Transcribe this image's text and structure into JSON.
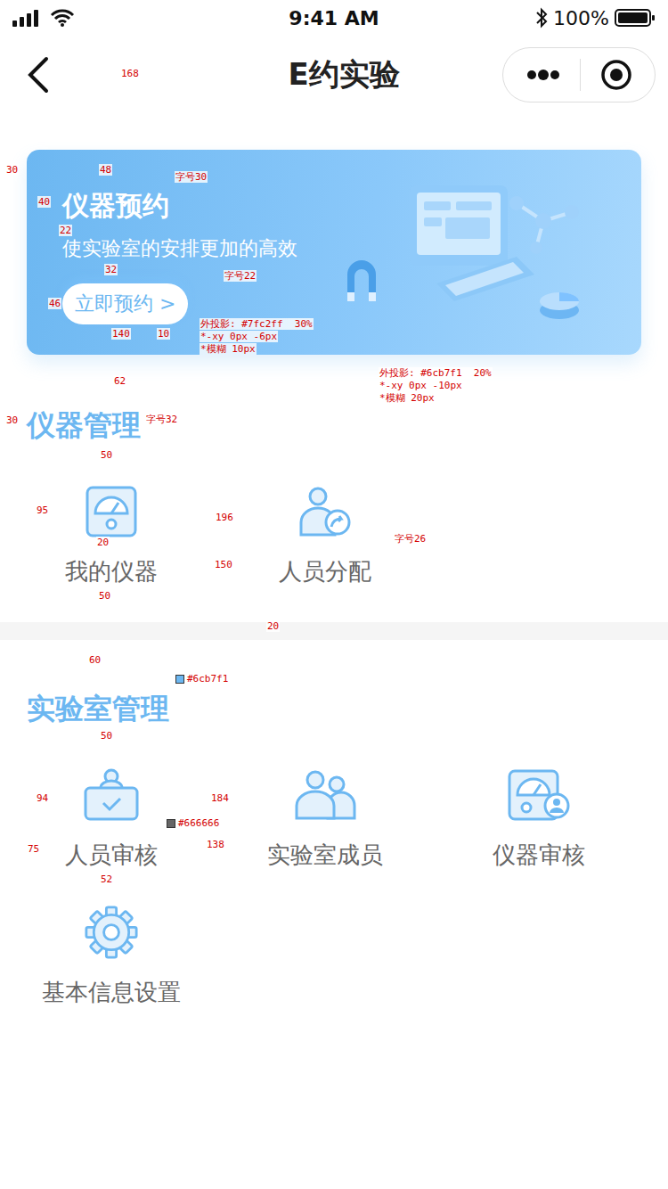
{
  "status_bar": {
    "time": "9:41 AM",
    "battery": "100%"
  },
  "nav": {
    "title": "E约实验"
  },
  "banner": {
    "title": "仪器预约",
    "subtitle": "使实验室的安排更加的高效",
    "button": "立即预约 >"
  },
  "sections": [
    {
      "title": "仪器管理",
      "items": [
        {
          "label": "我的仪器"
        },
        {
          "label": "人员分配"
        }
      ]
    },
    {
      "title": "实验室管理",
      "items": [
        {
          "label": "人员审核"
        },
        {
          "label": "实验室成员"
        },
        {
          "label": "仪器审核"
        },
        {
          "label": "基本信息设置"
        }
      ]
    }
  ],
  "annotations": [
    {
      "text": "168"
    },
    {
      "text": "30"
    },
    {
      "text": "48"
    },
    {
      "text": "40"
    },
    {
      "text": "字号30"
    },
    {
      "text": "22"
    },
    {
      "text": "32"
    },
    {
      "text": "字号22"
    },
    {
      "text": "46"
    },
    {
      "text": "140"
    },
    {
      "text": "10"
    },
    {
      "text": "外投影: #7fc2ff  30%"
    },
    {
      "text": "*-xy 0px -6px"
    },
    {
      "text": "*模糊 10px"
    },
    {
      "text": "外投影: #6cb7f1  20%"
    },
    {
      "text": "*-xy 0px -10px"
    },
    {
      "text": "*模糊 20px"
    },
    {
      "text": "62"
    },
    {
      "text": "30"
    },
    {
      "text": "字号32"
    },
    {
      "text": "50"
    },
    {
      "text": "95"
    },
    {
      "text": "196"
    },
    {
      "text": "20"
    },
    {
      "text": "字号26"
    },
    {
      "text": "150"
    },
    {
      "text": "50"
    },
    {
      "text": "20"
    },
    {
      "text": "60"
    },
    {
      "text": "#6cb7f1",
      "color": "#6cb7f1"
    },
    {
      "text": "50"
    },
    {
      "text": "94"
    },
    {
      "text": "184"
    },
    {
      "text": "#666666",
      "color": "#666666"
    },
    {
      "text": "75"
    },
    {
      "text": "138"
    },
    {
      "text": "52"
    }
  ]
}
